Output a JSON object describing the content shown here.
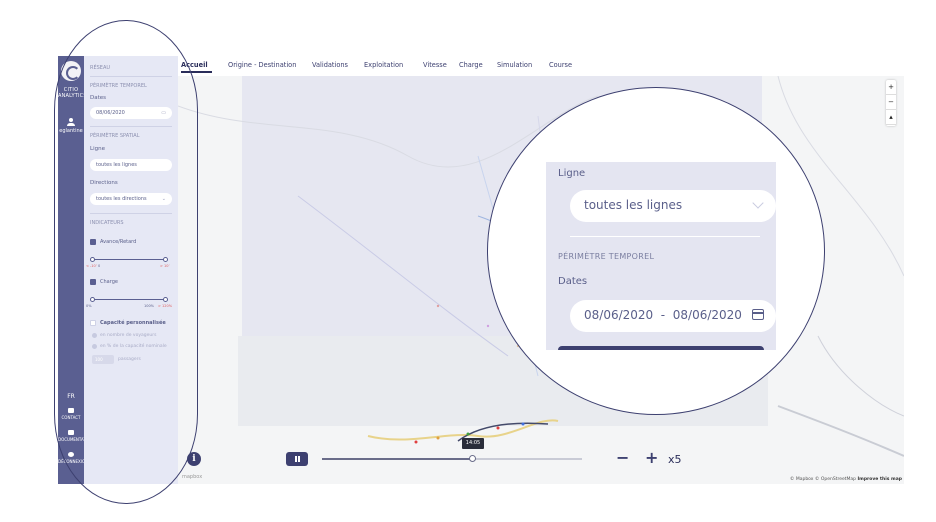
{
  "app": {
    "brand_line1": "CITIO",
    "brand_line2": "ANALYTICS",
    "user_name": "eglantine",
    "language": "FR",
    "contact_label": "CONTACT",
    "docs_label": "DOCUMENTATION",
    "logout_label": "DÉCONNEXION"
  },
  "panel": {
    "section_reseau": "RÉSEAU",
    "section_temporel": "PÉRIMÈTRE TEMPOREL",
    "dates_label": "Dates",
    "date_value": "08/06/2020",
    "section_spatial": "PÉRIMÈTRE SPATIAL",
    "ligne_label": "Ligne",
    "ligne_value": "toutes les lignes",
    "directions_label": "Directions",
    "directions_value": "toutes les directions",
    "section_indicateurs": "INDICATEURS",
    "avance_label": "Avance/Retard",
    "avance_ticks": [
      "< -10’",
      "0",
      "> 10’"
    ],
    "charge_label": "Charge",
    "charge_ticks": [
      "0%",
      "100%",
      "> 120%"
    ],
    "capacite_label": "Capacité personnalisée",
    "radio1": "en nombre de voyageurs",
    "radio2": "en % de la capacité nominale",
    "capacite_value": "100",
    "capacite_unit": "passagers"
  },
  "tabs": [
    "Accueil",
    "Origine - Destination",
    "Validations",
    "Exploitation",
    "Vitesse",
    "Charge",
    "Simulation",
    "Course"
  ],
  "map": {
    "attribution": "© Mapbox © OpenStreetMap",
    "improve": "Improve this map",
    "mapbox_logo": "mapbox",
    "zoom_in": "+",
    "zoom_out": "−",
    "compass": "▴"
  },
  "playback": {
    "info": "i",
    "time": "14:05",
    "progress": 0.58,
    "speed_minus": "−",
    "speed_plus": "+",
    "speed": "x5"
  },
  "zoom_callout": {
    "ligne_label": "Ligne",
    "ligne_value": "toutes les lignes",
    "section_temporel": "PÉRIMÈTRE TEMPOREL",
    "dates_label": "Dates",
    "date_range": "08/06/2020  -  08/06/2020"
  },
  "colors": {
    "nav": "#5a5f91",
    "panel": "#e6e8f5",
    "accent": "#2a2d5a"
  }
}
